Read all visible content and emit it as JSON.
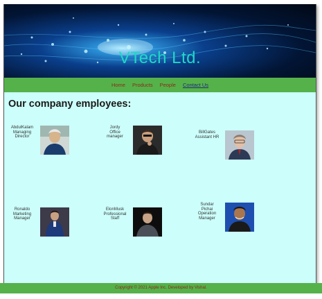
{
  "banner": {
    "title": "VTech Ltd."
  },
  "nav": {
    "items": [
      "Home",
      "Products",
      "People",
      "Contact Us"
    ]
  },
  "heading": "Our company employees:",
  "employees": [
    {
      "name": "AbdulKalam",
      "role_line1": "Managing",
      "role_line2": "Director"
    },
    {
      "name": "Jordy",
      "role_line1": "Office",
      "role_line2": "manager"
    },
    {
      "name": "BillGates",
      "role_line1": "Assistant HR",
      "role_line2": ""
    },
    {
      "name": "Ronaldo",
      "role_line1": "Marketing",
      "role_line2": "Manager"
    },
    {
      "name": "ElonMusk",
      "role_line1": "Professional",
      "role_line2": "Staff"
    },
    {
      "name": "Sundar",
      "name_line2": "Pichai",
      "role_line1": "Operation",
      "role_line2": "Manager"
    }
  ],
  "footer": {
    "text": "Copyright © 2021 Apple Inc. Developed by Vishal."
  },
  "colors": {
    "nav_bar": "#55b24a",
    "page_bg": "#ccfffb",
    "brand_text": "#1fd8c6",
    "nav_link": "#8a2a1c"
  }
}
